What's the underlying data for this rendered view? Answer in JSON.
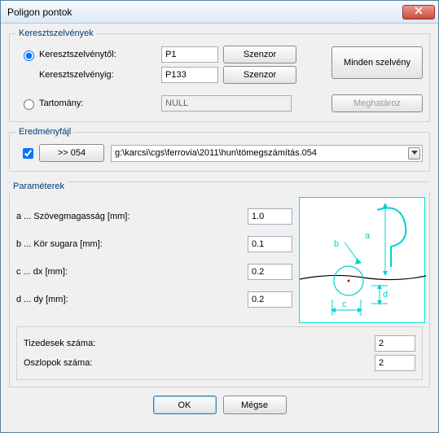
{
  "window": {
    "title": "Poligon pontok"
  },
  "groups": {
    "cross": {
      "legend": "Keresztszelvények",
      "from_label": "Keresztszelvénytől:",
      "to_label": "Keresztszelvényig:",
      "from_value": "P1",
      "to_value": "P133",
      "sensor_label": "Szenzor",
      "all_label": "Minden szelvény",
      "range_label": "Tartomány:",
      "range_value": "NULL",
      "define_label": "Meghatároz",
      "mode_from_to_selected": true,
      "mode_range_selected": false
    },
    "result": {
      "legend": "Eredményfájl",
      "checked": true,
      "gen_label": ">> 054",
      "path": "g:\\karcsi\\cgs\\ferrovia\\2011\\hun\\tömegszámítás.054"
    },
    "params": {
      "legend": "Paraméterek",
      "a_label": "a ... Szövegmagasság [mm]:",
      "a_value": "1.0",
      "b_label": "b ... Kör sugara [mm]:",
      "b_value": "0.1",
      "c_label": "c ... dx [mm]:",
      "c_value": "0.2",
      "d_label": "d ... dy [mm]:",
      "d_value": "0.2",
      "decimals_label": "Tizedesek száma:",
      "decimals_value": "2",
      "columns_label": "Oszlopok száma:",
      "columns_value": "2"
    }
  },
  "buttons": {
    "ok": "OK",
    "cancel": "Mégse"
  },
  "icons": {
    "close": "close-icon",
    "dropdown": "chevron-down-icon"
  }
}
